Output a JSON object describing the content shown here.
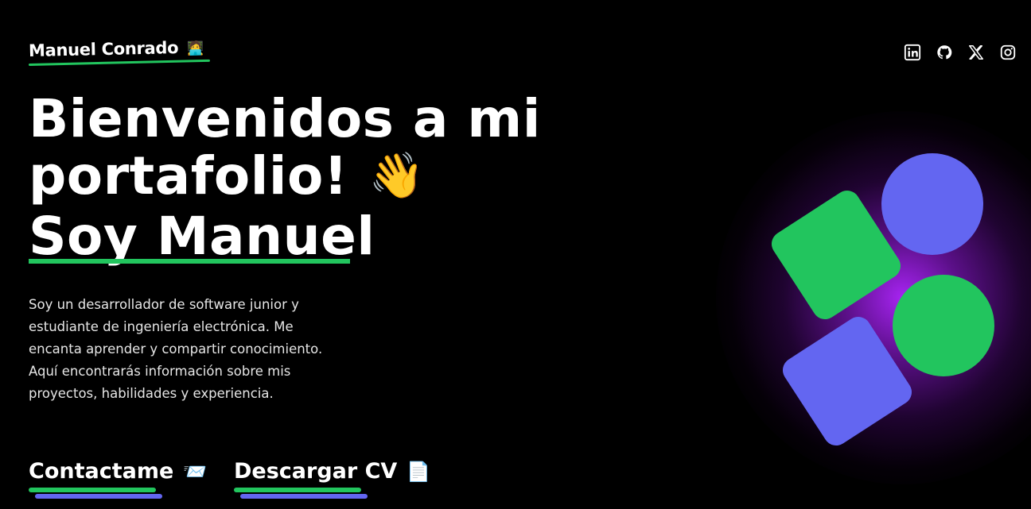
{
  "header": {
    "brand_name": "Manuel Conrado",
    "brand_emoji": "🧑‍💻",
    "social_links": [
      {
        "name": "linkedin-icon"
      },
      {
        "name": "github-icon"
      },
      {
        "name": "x-icon"
      },
      {
        "name": "instagram-icon"
      }
    ]
  },
  "hero": {
    "title_line1": "Bienvenidos a mi",
    "title_line2": "portafolio!",
    "wave_emoji": "👋",
    "title_line3": "Soy Manuel",
    "bio": "Soy un desarrollador de software junior y estudiante de ingeniería electrónica. Me encanta aprender y compartir conocimiento. Aquí encontrarás información sobre mis proyectos, habilidades y experiencia."
  },
  "actions": {
    "contact_label": "Contactame",
    "contact_emoji": "📨",
    "cv_label": "Descargar CV",
    "cv_emoji": "📄"
  },
  "colors": {
    "accent_green": "#22c55e",
    "accent_blue": "#6366f1",
    "glow_purple": "#b026ff",
    "background": "#000000"
  }
}
